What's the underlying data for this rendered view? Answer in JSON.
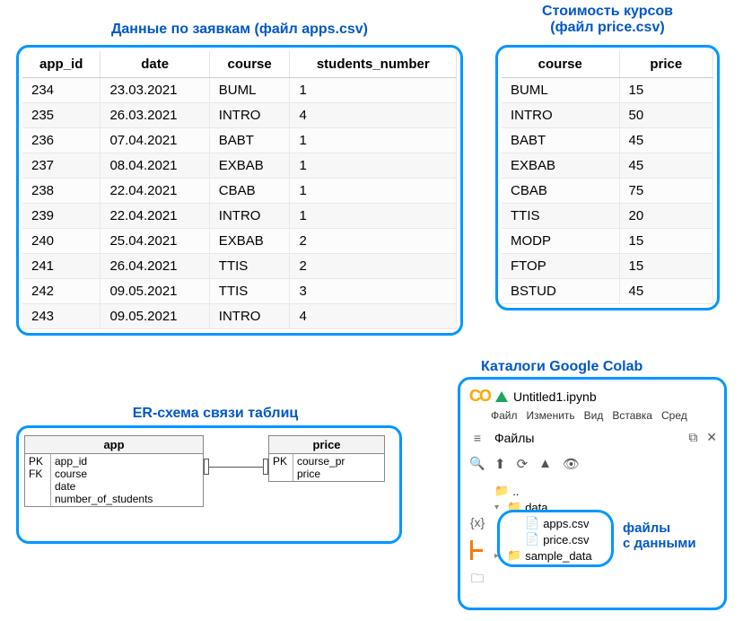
{
  "apps": {
    "title": "Данные по заявкам (файл apps.csv)",
    "headers": {
      "c0": "app_id",
      "c1": "date",
      "c2": "course",
      "c3": "students_number"
    },
    "rows": [
      {
        "c0": "234",
        "c1": "23.03.2021",
        "c2": "BUML",
        "c3": "1"
      },
      {
        "c0": "235",
        "c1": "26.03.2021",
        "c2": "INTRO",
        "c3": "4"
      },
      {
        "c0": "236",
        "c1": "07.04.2021",
        "c2": "BABT",
        "c3": "1"
      },
      {
        "c0": "237",
        "c1": "08.04.2021",
        "c2": "EXBAB",
        "c3": "1"
      },
      {
        "c0": "238",
        "c1": "22.04.2021",
        "c2": "CBAB",
        "c3": "1"
      },
      {
        "c0": "239",
        "c1": "22.04.2021",
        "c2": "INTRO",
        "c3": "1"
      },
      {
        "c0": "240",
        "c1": "25.04.2021",
        "c2": "EXBAB",
        "c3": "2"
      },
      {
        "c0": "241",
        "c1": "26.04.2021",
        "c2": "TTIS",
        "c3": "2"
      },
      {
        "c0": "242",
        "c1": "09.05.2021",
        "c2": "TTIS",
        "c3": "3"
      },
      {
        "c0": "243",
        "c1": "09.05.2021",
        "c2": "INTRO",
        "c3": "4"
      }
    ]
  },
  "price": {
    "title_line1": "Стоимость курсов",
    "title_line2": "(файл price.csv)",
    "headers": {
      "c0": "course",
      "c1": "price"
    },
    "rows": [
      {
        "c0": "BUML",
        "c1": "15"
      },
      {
        "c0": "INTRO",
        "c1": "50"
      },
      {
        "c0": "BABT",
        "c1": "45"
      },
      {
        "c0": "EXBAB",
        "c1": "45"
      },
      {
        "c0": "CBAB",
        "c1": "75"
      },
      {
        "c0": "TTIS",
        "c1": "20"
      },
      {
        "c0": "MODP",
        "c1": "15"
      },
      {
        "c0": "FTOP",
        "c1": "15"
      },
      {
        "c0": "BSTUD",
        "c1": "45"
      }
    ]
  },
  "er": {
    "title": "ER-схема связи таблиц",
    "app": {
      "name": "app",
      "keys": {
        "k0": "PK",
        "k1": "FK"
      },
      "fields": {
        "f0": "app_id",
        "f1": "course",
        "f2": "date",
        "f3": "number_of_students"
      }
    },
    "price": {
      "name": "price",
      "keys": {
        "k0": "PK"
      },
      "fields": {
        "f0": "course_pr",
        "f1": "price"
      }
    }
  },
  "colab": {
    "title": "Каталоги Google Colab",
    "logo": "CO",
    "notebook": "Untitled1.ipynb",
    "menu": {
      "m0": "Файл",
      "m1": "Изменить",
      "m2": "Вид",
      "m3": "Вставка",
      "m4": "Сред"
    },
    "files_label": "Файлы",
    "tree": {
      "up": "..",
      "data": "data",
      "apps": "apps.csv",
      "price": "price.csv",
      "sample": "sample_data"
    },
    "callout_line1": "файлы",
    "callout_line2": "с данными"
  }
}
